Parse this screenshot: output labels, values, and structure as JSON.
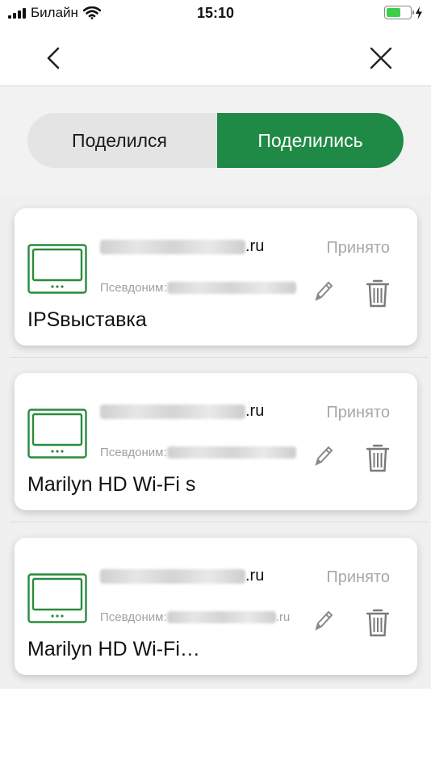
{
  "status_bar": {
    "carrier": "Билайн",
    "time": "15:10"
  },
  "nav": {
    "back_icon": "chevron-left-icon",
    "close_icon": "close-icon"
  },
  "tabs": {
    "left_label": "Поделился",
    "right_label": "Поделились",
    "selected": "right",
    "accent": "#1f8a45"
  },
  "devices": [
    {
      "email_suffix": ".ru",
      "alias_label": "Псевдоним:",
      "alias_suffix": "",
      "name": "IPSвыставка",
      "status": "Принято"
    },
    {
      "email_suffix": ".ru",
      "alias_label": "Псевдоним:",
      "alias_suffix": "",
      "name": "Marilyn HD Wi-Fi s",
      "status": "Принято"
    },
    {
      "email_suffix": ".ru",
      "alias_label": "Псевдоним:",
      "alias_suffix": ".ru",
      "name": "Marilyn HD Wi-Fi…",
      "status": "Принято"
    }
  ],
  "icons": {
    "device": "monitor-icon",
    "edit": "pencil-icon",
    "delete": "trash-icon"
  }
}
